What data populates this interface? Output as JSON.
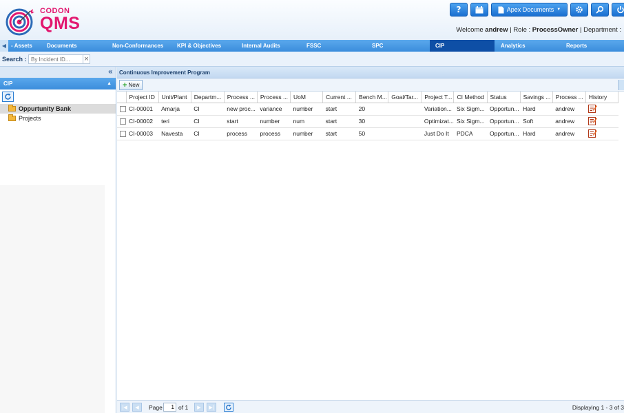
{
  "app": {
    "brand_top": "CODON",
    "brand_main": "QMS"
  },
  "topbar": {
    "apex_label": "Apex Documents",
    "welcome_prefix": "Welcome",
    "user": "andrew",
    "role_label": "Role :",
    "role": "ProcessOwner",
    "dept_label": "Department :"
  },
  "nav": {
    "tabs": [
      {
        "label": "- Assets"
      },
      {
        "label": "Documents"
      },
      {
        "label": "Non-Conformances"
      },
      {
        "label": "KPI & Objectives"
      },
      {
        "label": "Internal Audits"
      },
      {
        "label": "FSSC"
      },
      {
        "label": "SPC"
      },
      {
        "label": "CIP"
      },
      {
        "label": "Analytics"
      },
      {
        "label": "Reports"
      }
    ],
    "active": "CIP"
  },
  "search": {
    "label": "Search :",
    "placeholder": "By Incident ID...",
    "clear": "×"
  },
  "left_panel": {
    "collapse": "«",
    "header": "CIP",
    "tree": [
      {
        "label": "Oppurtunity Bank"
      },
      {
        "label": "Projects"
      }
    ]
  },
  "main": {
    "title": "Continuous Improvement Program",
    "new_label": "New",
    "columns": [
      "Project ID",
      "Unit/Plant",
      "Departm...",
      "Process ...",
      "Process ...",
      "UoM",
      "Current ...",
      "Bench M...",
      "Goal/Tar...",
      "Project T...",
      "CI Method",
      "Status",
      "Savings ...",
      "Process ...",
      "History"
    ],
    "rows": [
      [
        "CI-00001",
        "Amarja",
        "CI",
        "new proc...",
        "variance",
        "number",
        "start",
        "20",
        "",
        "Variation...",
        "Six Sigm...",
        "Opportun...",
        "Hard",
        "andrew"
      ],
      [
        "CI-00002",
        "teri",
        "CI",
        "start",
        "number",
        "num",
        "start",
        "30",
        "",
        "Optimizat...",
        "Six Sigm...",
        "Opportun...",
        "Soft",
        "andrew"
      ],
      [
        "CI-00003",
        "Navesta",
        "CI",
        "process",
        "process",
        "number",
        "start",
        "50",
        "",
        "Just Do It",
        "PDCA",
        "Opportun...",
        "Hard",
        "andrew"
      ]
    ]
  },
  "pager": {
    "page_label": "Page",
    "page_value": "1",
    "of_label": "of 1",
    "display_text": "Displaying 1 - 3 of 3"
  },
  "colors": {
    "nav_blue": "#3b8ddc",
    "nav_active": "#0e4fa6",
    "brand_pink": "#e2186f"
  }
}
